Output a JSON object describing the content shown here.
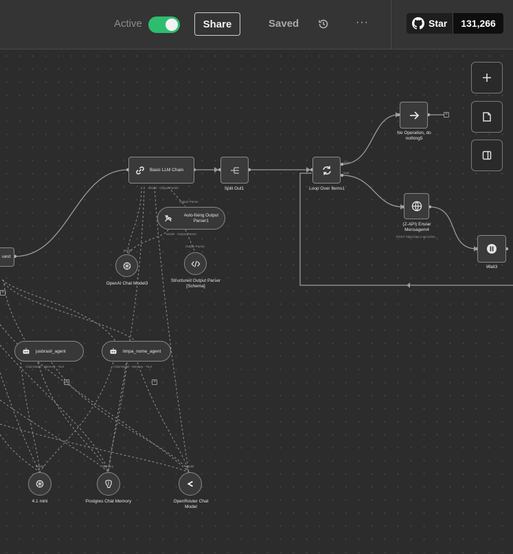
{
  "header": {
    "active_label": "Active",
    "active": true,
    "share_label": "Share",
    "saved_label": "Saved",
    "more_label": "···",
    "github_star_label": "Star",
    "github_star_count": "131,266"
  },
  "canvas": {
    "controls": [
      "zoom-in",
      "add-sticky-note",
      "toggle-panel"
    ],
    "nodes": {
      "request_partial": "uest",
      "basic_llm_chain": "Basic LLM Chain",
      "basic_llm_chain_ports": "Model · Output Parser",
      "split_out": "Split Out1",
      "loop_over_items": "Loop Over Items1",
      "no_operation": "No Operation, do nothing5",
      "zapi_enviar": "(Z-API) Enviar Mensagem4",
      "zapi_enviar_sub": "POST: https://api.z-api.io/ins...",
      "wait": "Wait3",
      "auto_fixing": "Auto-fixing Output Parser1",
      "auto_fixing_top": "Output Parser",
      "auto_fixing_ports": "Model · Output Parser",
      "openai_chat_model": "OpenAI Chat Model3",
      "openai_chat_model_top": "Model",
      "structured_parser": "Structured Output Parser [Schema]",
      "structured_parser_top": "Output Parser",
      "jusbrasil_agent": "jusbrasil_agent",
      "jusbrasil_ports": "Chat Model · Memory · Tool",
      "limpa_nome_agent": "limpa_nome_agent",
      "limpa_ports": "Chat Model · Memory · Tool",
      "gpt41mini": "4.1 mini",
      "gpt41mini_top": "Model",
      "postgres_memory": "Postgres Chat Memory",
      "postgres_top": "Memory",
      "openrouter_model": "OpenRouter Chat Model",
      "openrouter_top": "Model",
      "loop_done": "done",
      "loop_loop": "loop"
    }
  }
}
